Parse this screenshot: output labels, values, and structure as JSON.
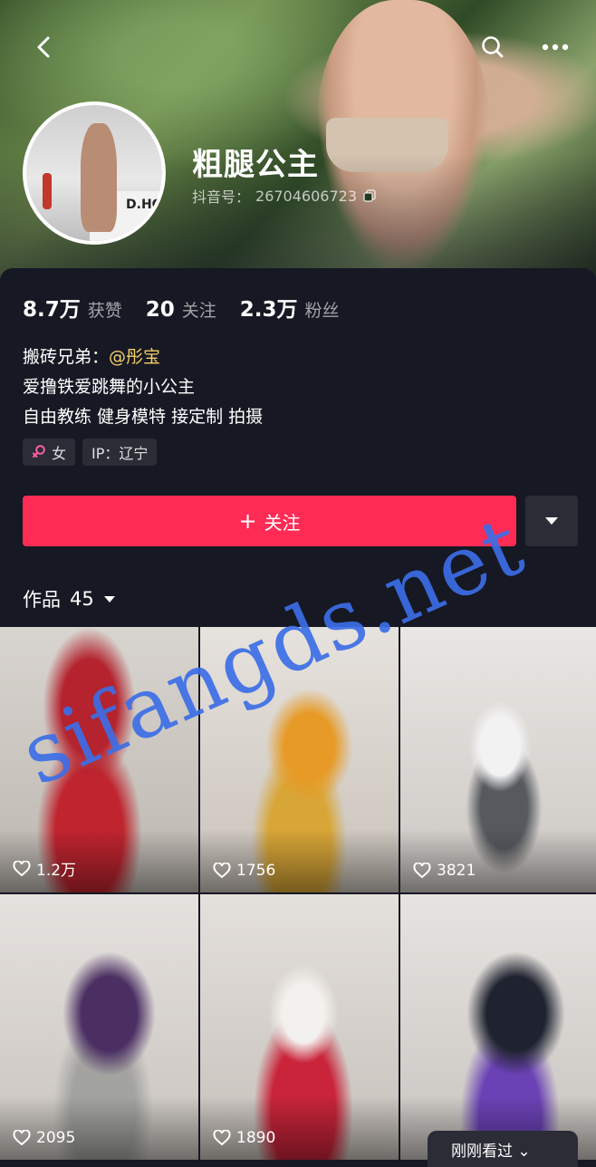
{
  "profile": {
    "name": "粗腿公主",
    "uid_label": "抖音号：",
    "uid": "26704606723",
    "avatar_wall_text": "D.HC"
  },
  "stats": [
    {
      "num": "8.7万",
      "label": "获赞"
    },
    {
      "num": "20",
      "label": "关注"
    },
    {
      "num": "2.3万",
      "label": "粉丝"
    }
  ],
  "bio": {
    "line1_prefix": "搬砖兄弟：",
    "mention": "@彤宝",
    "line2": "爱撸铁爱跳舞的小公主",
    "line3": "自由教练 健身模特 接定制 拍摄"
  },
  "tags": {
    "gender": "女",
    "gender_icon": "female-icon",
    "ip": "IP：辽宁"
  },
  "actions": {
    "follow_label": "关注",
    "follow_plus": "+",
    "more_icon": "caret-down-icon"
  },
  "works": {
    "label": "作品",
    "count": "45"
  },
  "tiles": [
    {
      "likes": "1.2万"
    },
    {
      "likes": "1756"
    },
    {
      "likes": "3821"
    },
    {
      "likes": "2095"
    },
    {
      "likes": "1890"
    },
    {
      "likes": ""
    }
  ],
  "toast": {
    "text": "刚刚看过 ⌄"
  },
  "watermark": {
    "text": "sifangds.net"
  },
  "colors": {
    "accent": "#fe2c55",
    "background": "#161823",
    "mention": "#f4cf6a",
    "watermark": "#3c6ee6"
  }
}
